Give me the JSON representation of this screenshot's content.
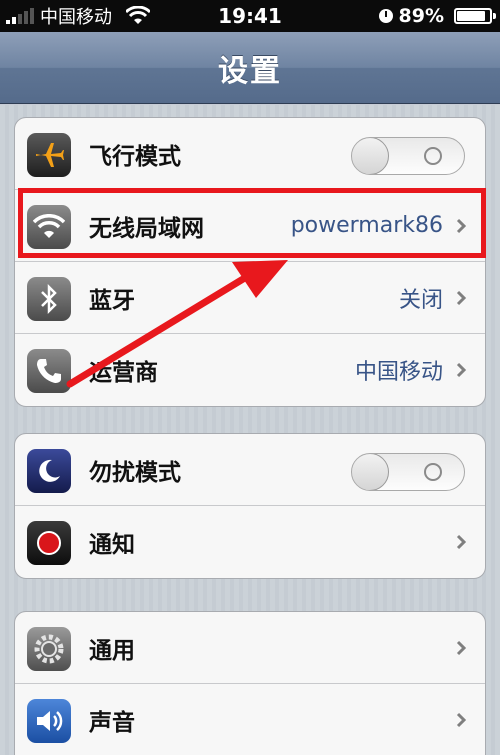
{
  "status_bar": {
    "carrier": "中国移动",
    "time": "19:41",
    "battery_text": "89%",
    "battery_level": 0.89
  },
  "nav": {
    "title": "设置"
  },
  "group1": [
    {
      "label": "飞行模式",
      "icon": "airplane-icon",
      "toggle": "off"
    },
    {
      "label": "无线局域网",
      "icon": "wifi-icon",
      "value": "powermark86"
    },
    {
      "label": "蓝牙",
      "icon": "bluetooth-icon",
      "value": "关闭"
    },
    {
      "label": "运营商",
      "icon": "phone-icon",
      "value": "中国移动"
    }
  ],
  "group2": [
    {
      "label": "勿扰模式",
      "icon": "moon-icon",
      "toggle": "off"
    },
    {
      "label": "通知",
      "icon": "notification-icon"
    }
  ],
  "group3": [
    {
      "label": "通用",
      "icon": "gear-icon"
    },
    {
      "label": "声音",
      "icon": "speaker-icon"
    }
  ],
  "colors": {
    "highlight": "#e8181d",
    "value_text": "#385487",
    "nav_bar": "#6f84a2"
  }
}
